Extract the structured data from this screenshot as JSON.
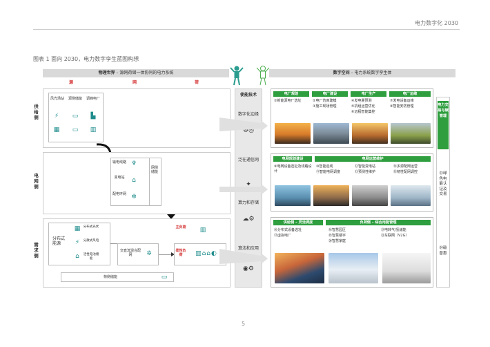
{
  "header": {
    "title": "电力数字化 2030"
  },
  "caption": "图表 1 面向 2030，电力数字孪生蓝图构想",
  "page_number": "5",
  "left_banner": {
    "bold": "物理世界",
    "text": " – 源网荷储一体协同的电力系统"
  },
  "right_banner": {
    "bold": "数字空间",
    "text": " – 电力系统数字孪生体"
  },
  "columns": {
    "source": "源",
    "grid": "网",
    "load": "荷"
  },
  "rows": {
    "supply": "供给侧",
    "grid": "电网侧",
    "demand": "需求侧"
  },
  "supply": {
    "wind_solar": "风光场站",
    "storage_plant": "源侧储能",
    "peaking": "调峰电厂"
  },
  "grid_side": {
    "transmission": "输电线路",
    "substation": "变电站",
    "distribution": "配电环网",
    "grid_storage": "网侧储能"
  },
  "demand": {
    "distributed": "分布式能源",
    "dist_solar": "分布式光伏",
    "dist_wind": "分散式风电",
    "dist_storage": "活性电池储能",
    "microgrid": "交直流混合配网",
    "main_load": "主负荷",
    "flex_load": "柔性负荷",
    "load_storage": "荷侧储能"
  },
  "middle": {
    "title": "使能技术",
    "items": [
      "数字化边缘",
      "泛在通信网",
      "算力和存储",
      "算法和应用"
    ]
  },
  "plant": {
    "tags": [
      "电厂规划",
      "电厂建设",
      "电厂生产",
      "电厂运维"
    ],
    "items": [
      "①新能源电厂选址",
      "②电厂仿真建模",
      "③施工现场管理",
      "④发电量预测",
      "⑤机组运营优化",
      "⑥远程智能集控",
      "⑦发电设备运维",
      "⑧智能安防管理"
    ]
  },
  "grid_mgmt": {
    "tags": [
      "电网规划建设",
      "电网运营维护"
    ],
    "items": [
      "⑨电网设备选址及线路设计",
      "⑩智能巡线",
      "⑪智能电网调度",
      "⑫智能变电站",
      "⑬预测性维护",
      "⑭多源配网运营",
      "⑮韧性配网调控"
    ]
  },
  "demand_mgmt": {
    "tags": [
      "供给侧 – 灵活调度",
      "负荷侧 – 综合用能管理"
    ],
    "items": [
      "⑯分布式设备选址",
      "⑰虚拟电厂",
      "⑱智慧园区",
      "⑲智慧楼宇",
      "⑳智慧家庭",
      "㉑电转气/氢储能",
      "㉒车联网（V2G）"
    ]
  },
  "right_col": {
    "title": "电力交易与碳管理",
    "item1": "㉓绿色电能认证及交易",
    "item2": "㉔碳普惠"
  }
}
